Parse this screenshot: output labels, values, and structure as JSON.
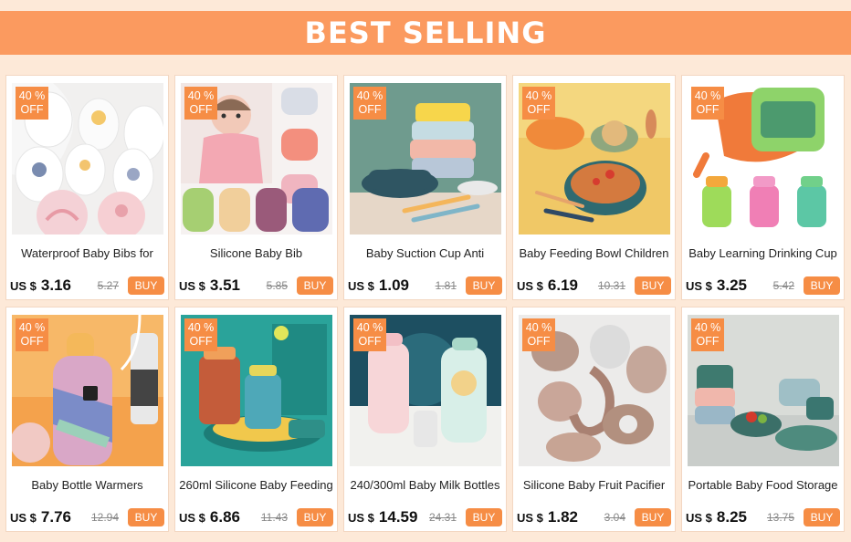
{
  "banner": {
    "title": "BEST SELLING"
  },
  "currency": "US $",
  "buy_label": "BUY",
  "colors": {
    "accent": "#f68d45",
    "banner": "#fb9a5f",
    "background": "#fde9d8"
  },
  "products": [
    {
      "discount_pct": "40 %",
      "discount_off": "OFF",
      "title": "Waterproof Baby Bibs for",
      "price": "3.16",
      "old_price": "5.27",
      "image": "bibs-flat-lay"
    },
    {
      "discount_pct": "40 %",
      "discount_off": "OFF",
      "title": "Silicone Baby Bib",
      "price": "3.51",
      "old_price": "5.85",
      "image": "baby-with-bibs"
    },
    {
      "discount_pct": "40 %",
      "discount_off": "OFF",
      "title": "Baby Suction Cup Anti",
      "price": "1.09",
      "old_price": "1.81",
      "image": "stacked-suction-bowls"
    },
    {
      "discount_pct": "40 %",
      "discount_off": "OFF",
      "title": "Baby Feeding Bowl Children",
      "price": "6.19",
      "old_price": "10.31",
      "image": "feeding-bowls"
    },
    {
      "discount_pct": "40 %",
      "discount_off": "OFF",
      "title": "Baby Learning Drinking Cup",
      "price": "3.25",
      "old_price": "5.42",
      "image": "sippy-cups"
    },
    {
      "discount_pct": "40 %",
      "discount_off": "OFF",
      "title": "Baby Bottle Warmers",
      "price": "7.76",
      "old_price": "12.94",
      "image": "bottle-warmer"
    },
    {
      "discount_pct": "40 %",
      "discount_off": "OFF",
      "title": "260ml Silicone Baby Feeding",
      "price": "6.86",
      "old_price": "11.43",
      "image": "straw-cups"
    },
    {
      "discount_pct": "40 %",
      "discount_off": "OFF",
      "title": "240/300ml Baby Milk Bottles",
      "price": "14.59",
      "old_price": "24.31",
      "image": "milk-bottles"
    },
    {
      "discount_pct": "40 %",
      "discount_off": "OFF",
      "title": "Silicone Baby Fruit Pacifier",
      "price": "1.82",
      "old_price": "3.04",
      "image": "fruit-pacifiers"
    },
    {
      "discount_pct": "40 %",
      "discount_off": "OFF",
      "title": "Portable Baby Food Storage",
      "price": "8.25",
      "old_price": "13.75",
      "image": "food-storage"
    }
  ]
}
